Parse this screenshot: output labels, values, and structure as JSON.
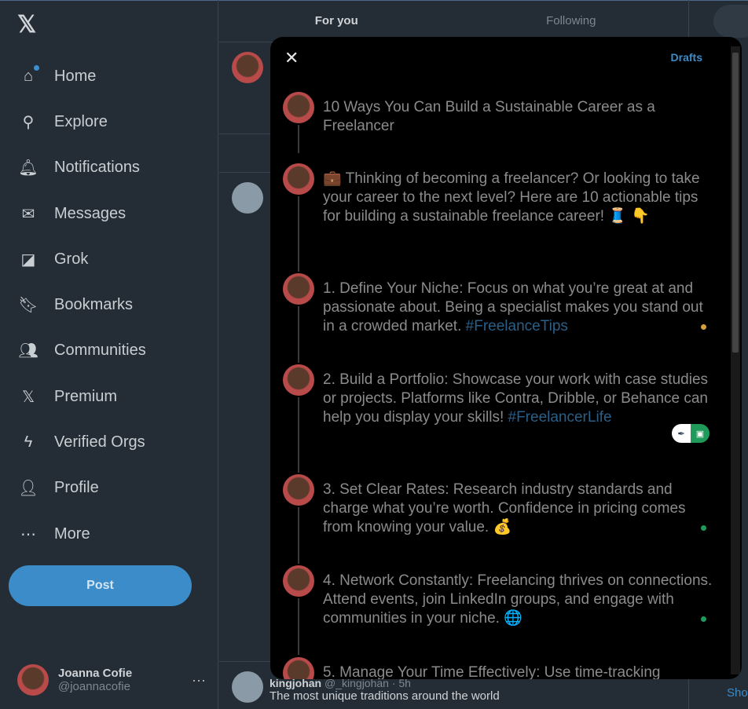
{
  "sidebar": {
    "logo": "𝕏",
    "items": [
      {
        "label": "Home",
        "icon": "home-icon",
        "glyph": "⌂"
      },
      {
        "label": "Explore",
        "icon": "search-icon",
        "glyph": "⚲"
      },
      {
        "label": "Notifications",
        "icon": "bell-icon",
        "glyph": "🔔︎"
      },
      {
        "label": "Messages",
        "icon": "mail-icon",
        "glyph": "✉"
      },
      {
        "label": "Grok",
        "icon": "grok-icon",
        "glyph": "◪"
      },
      {
        "label": "Bookmarks",
        "icon": "bookmark-icon",
        "glyph": "🔖︎"
      },
      {
        "label": "Communities",
        "icon": "people-icon",
        "glyph": "👥︎"
      },
      {
        "label": "Premium",
        "icon": "x-icon",
        "glyph": "𝕏"
      },
      {
        "label": "Verified Orgs",
        "icon": "lightning-icon",
        "glyph": "ϟ"
      },
      {
        "label": "Profile",
        "icon": "person-icon",
        "glyph": "👤︎"
      },
      {
        "label": "More",
        "icon": "more-circle-icon",
        "glyph": "⋯"
      }
    ],
    "post_label": "Post",
    "account": {
      "name": "Joanna Cofie",
      "handle": "@joannacofie",
      "more": "···"
    }
  },
  "main": {
    "tabs": [
      "For you",
      "Following"
    ],
    "bottom_post": {
      "author": "kingjohan",
      "handle": "@_kingjohan · 5h",
      "text": "The most unique traditions around the world"
    }
  },
  "right": {
    "show_more": "Sho"
  },
  "modal": {
    "close": "✕",
    "drafts": "Drafts",
    "posts": [
      {
        "text": "10 Ways You Can Build a Sustainable Career as a Freelancer"
      },
      {
        "text": "💼  Thinking of becoming a freelancer? Or looking to take your career to the next level? Here are 10 actionable tips for building a sustainable freelance career! 🧵  👇"
      },
      {
        "text": "1. Define Your Niche: Focus on what you’re great at and passionate about. Being a specialist makes you stand out in a crowded market. ",
        "tag": "#FreelanceTips"
      },
      {
        "text": "2. Build a Portfolio: Showcase your work with case studies or projects. Platforms like Contra, Dribble, or Behance can help you display your skills! ",
        "tag": "#FreelancerLife"
      },
      {
        "text": "3. Set Clear Rates: Research industry standards and charge what you’re worth. Confidence in pricing comes from knowing your value.  💰"
      },
      {
        "text": "4. Network Constantly: Freelancing thrives on connections. Attend events, join LinkedIn groups, and engage with communities in your niche.  🌐"
      },
      {
        "text": "5. Manage Your Time Effectively: Use time-tracking"
      }
    ],
    "colors": {
      "accent": "#3b8cc8",
      "hashtag": "#2a5f88",
      "indicator_yellow": "#d4a03a",
      "indicator_green": "#1f9a5a"
    }
  }
}
